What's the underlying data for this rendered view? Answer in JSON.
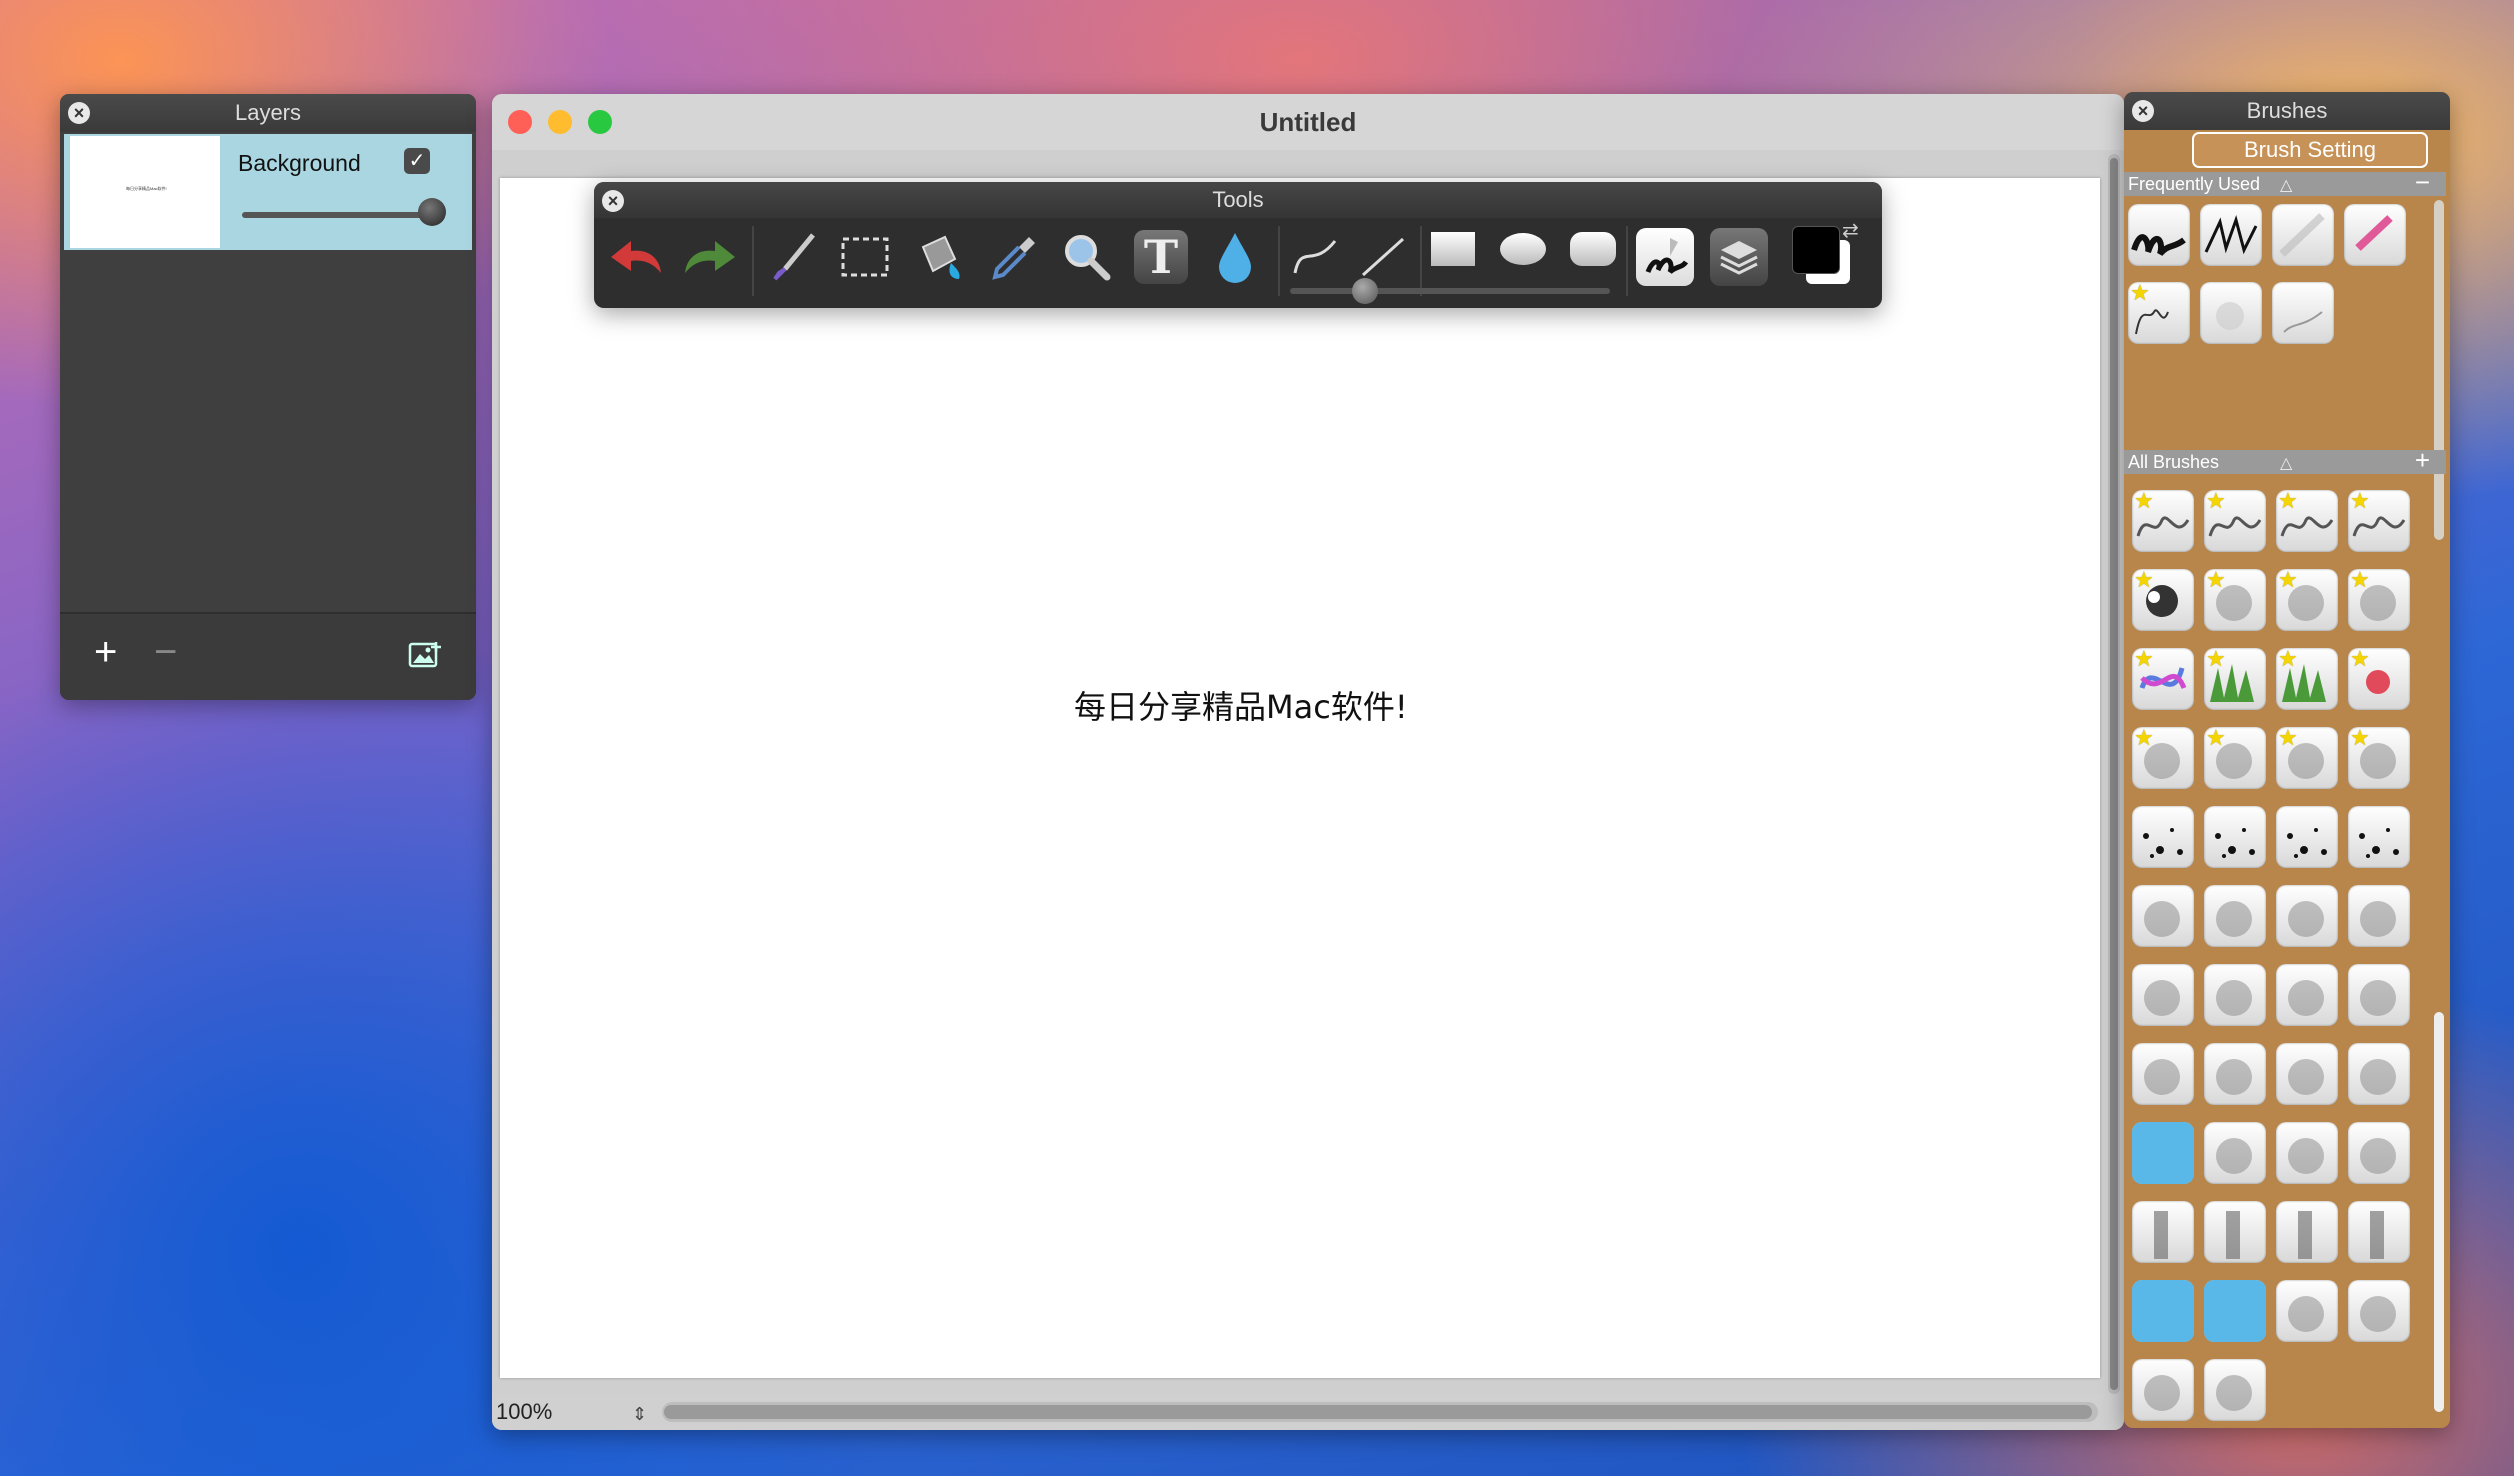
{
  "layers_panel": {
    "title": "Layers",
    "layers": [
      {
        "name": "Background",
        "visible": true,
        "thumbnail_text": "每日分享精品Mac软件!"
      }
    ],
    "opacity": 1.0
  },
  "main_window": {
    "title": "Untitled",
    "canvas_text": "每日分享精品Mac软件!",
    "zoom": "100%"
  },
  "tools_panel": {
    "title": "Tools",
    "tools": [
      "undo-icon",
      "redo-icon",
      "paintbrush-icon",
      "marquee-select-icon",
      "paint-bucket-icon",
      "eyedropper-icon",
      "magnifier-icon",
      "text-tool-icon",
      "blur-drop-icon",
      "curve-tool-icon",
      "line-tool-icon",
      "rectangle-tool-icon",
      "ellipse-tool-icon",
      "rounded-rect-tool-icon",
      "brush-preview-icon",
      "layers-icon",
      "color-swatches"
    ],
    "primary_color": "#000000",
    "secondary_color": "#ffffff"
  },
  "brushes_panel": {
    "title": "Brushes",
    "setting_button": "Brush Setting",
    "frequently_used_label": "Frequently Used",
    "all_brushes_label": "All Brushes",
    "frequently_used": [
      "calligraphy",
      "ink pen",
      "pencil",
      "marker",
      "scribble",
      "smudge",
      "fountain pen"
    ],
    "all_brushes_count": 46
  },
  "colors": {
    "panel_dark": "#3f3f3f",
    "layer_selected": "#a9d6e0",
    "brush_panel_bg": "#b8864a"
  }
}
